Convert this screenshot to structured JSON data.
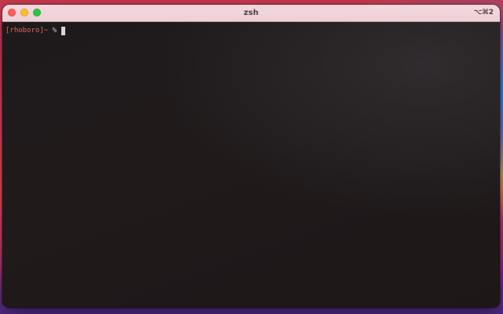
{
  "window": {
    "title": "zsh",
    "shortcut": "⌥⌘2"
  },
  "traffic_lights": {
    "close_color": "#fe5f57",
    "minimize_color": "#febc2e",
    "zoom_color": "#28c840"
  },
  "terminal": {
    "prompt_user": "[rhoboro]~",
    "prompt_symbol": " % ",
    "input": ""
  },
  "colors": {
    "terminal_bg": "#1f1a1b",
    "prompt_user": "#d96b5a",
    "titlebar_bg": "#f3d7dc"
  }
}
